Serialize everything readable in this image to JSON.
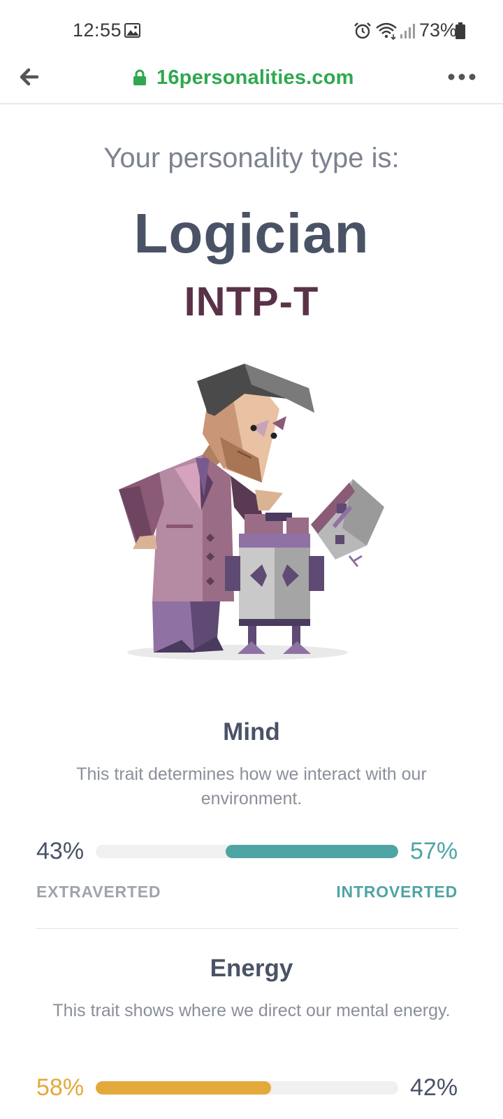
{
  "status_bar": {
    "time": "12:55",
    "battery": "73%",
    "icons": [
      "gallery-icon",
      "alarm-icon",
      "wifi-icon",
      "signal-icon",
      "battery-icon"
    ]
  },
  "browser": {
    "url": "16personalities.com",
    "icons": [
      "back-arrow-icon",
      "lock-icon",
      "more-dots-icon"
    ],
    "url_color": "#2fa84f"
  },
  "result": {
    "intro": "Your personality type is:",
    "type_name": "Logician",
    "type_code": "INTP-T",
    "illustration": "logician-figure-with-robot-illustration"
  },
  "traits": [
    {
      "title": "Mind",
      "description": "This trait determines how we interact with our environment.",
      "left_pct": "43%",
      "right_pct": "57%",
      "left_label": "EXTRAVERTED",
      "right_label": "INTROVERTED",
      "dominant": "right",
      "fill_fraction": 0.57,
      "color": "#4fa4a4"
    },
    {
      "title": "Energy",
      "description": "This trait shows where we direct our mental energy.",
      "left_pct": "58%",
      "right_pct": "42%",
      "dominant": "left",
      "fill_fraction": 0.58,
      "color": "#e3a93b"
    }
  ],
  "colors": {
    "text_dark": "#4a5366",
    "type_code": "#5a3248",
    "muted": "#8a8f9a"
  }
}
